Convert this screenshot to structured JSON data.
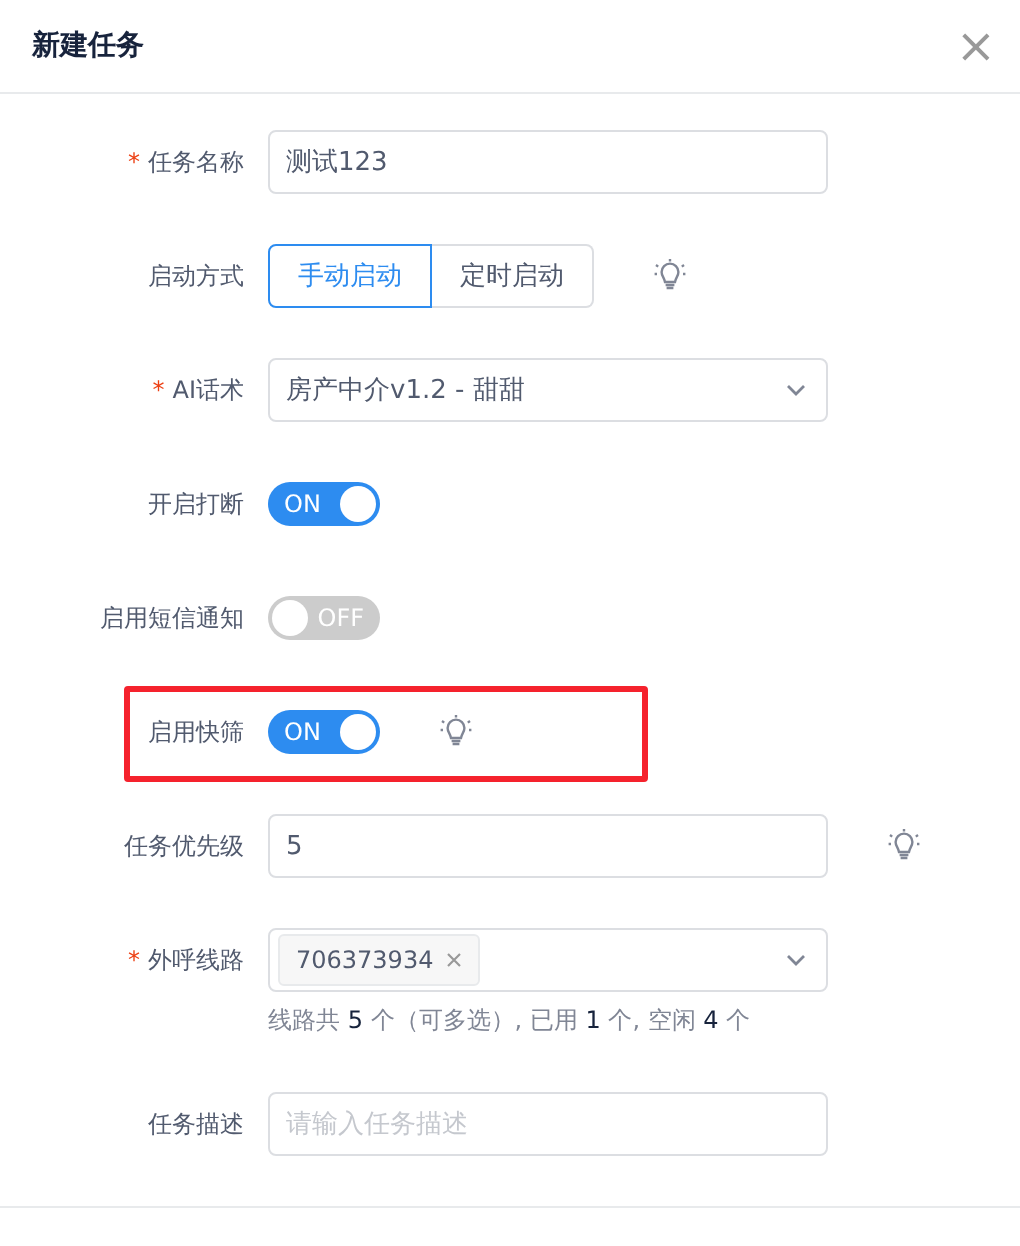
{
  "dialog": {
    "title": "新建任务",
    "close": "×"
  },
  "fields": [
    {
      "kind": "text",
      "label": "任务名称",
      "required_mark": "*",
      "value": "测试123"
    },
    {
      "kind": "segmented",
      "label": "启动方式",
      "hint_icon": true,
      "options": [
        {
          "label": "手动启动",
          "selected": true
        },
        {
          "label": "定时启动",
          "selected": false
        }
      ]
    },
    {
      "kind": "select",
      "label": "AI话术",
      "required_mark": "*",
      "value": "房产中介v1.2 - 甜甜"
    },
    {
      "kind": "switch",
      "label": "开启打断",
      "on": true,
      "text": "ON"
    },
    {
      "kind": "switch",
      "label": "启用短信通知",
      "on": false,
      "text": "OFF"
    },
    {
      "kind": "switch",
      "label": "启用快筛",
      "on": true,
      "text": "ON",
      "hint_icon": true,
      "highlighted": true
    },
    {
      "kind": "text",
      "label": "任务优先级",
      "value": "5",
      "hint_icon": true
    },
    {
      "kind": "tags",
      "label": "外呼线路",
      "required_mark": "*",
      "tags": [
        "706373934"
      ],
      "help": "线路共 **5** 个（可多选）, 已用 **1** 个, 空闲 **4** 个"
    },
    {
      "kind": "text",
      "label": "任务描述",
      "placeholder": "请输入任务描述"
    }
  ]
}
